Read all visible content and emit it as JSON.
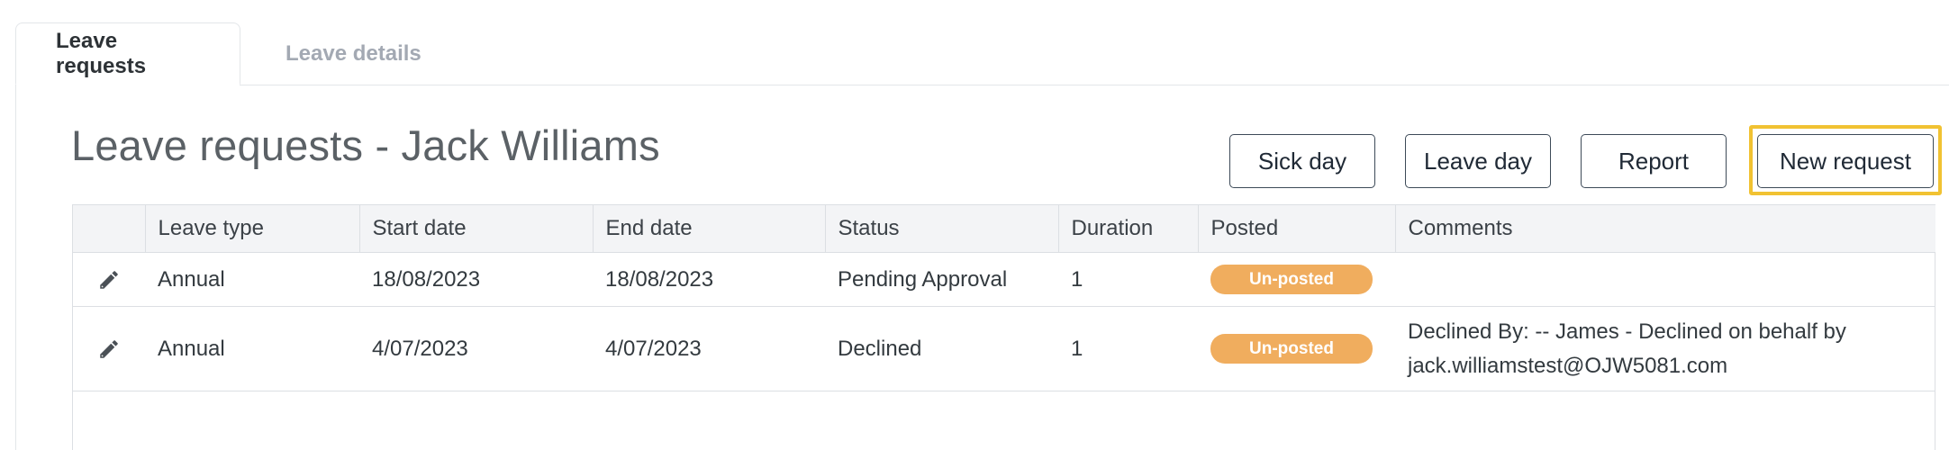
{
  "tabs": [
    {
      "label": "Leave requests",
      "active": true
    },
    {
      "label": "Leave details",
      "active": false
    }
  ],
  "page_title": "Leave requests - Jack Williams",
  "buttons": {
    "sick_day": "Sick day",
    "leave_day": "Leave day",
    "report": "Report",
    "new_request": "New request"
  },
  "table": {
    "columns": [
      "",
      "Leave type",
      "Start date",
      "End date",
      "Status",
      "Duration",
      "Posted",
      "Comments"
    ],
    "rows": [
      {
        "leave_type": "Annual",
        "start_date": "18/08/2023",
        "end_date": "18/08/2023",
        "status": "Pending Approval",
        "duration": "1",
        "posted": "Un-posted",
        "comments": ""
      },
      {
        "leave_type": "Annual",
        "start_date": "4/07/2023",
        "end_date": "4/07/2023",
        "status": "Declined",
        "duration": "1",
        "posted": "Un-posted",
        "comments": "Declined By: -- James - Declined on behalf by jack.williamstest@OJW5081.com"
      }
    ]
  },
  "colors": {
    "badge": "#f0ad5e",
    "highlight": "#f1c232",
    "button_border": "#3d4a58"
  }
}
